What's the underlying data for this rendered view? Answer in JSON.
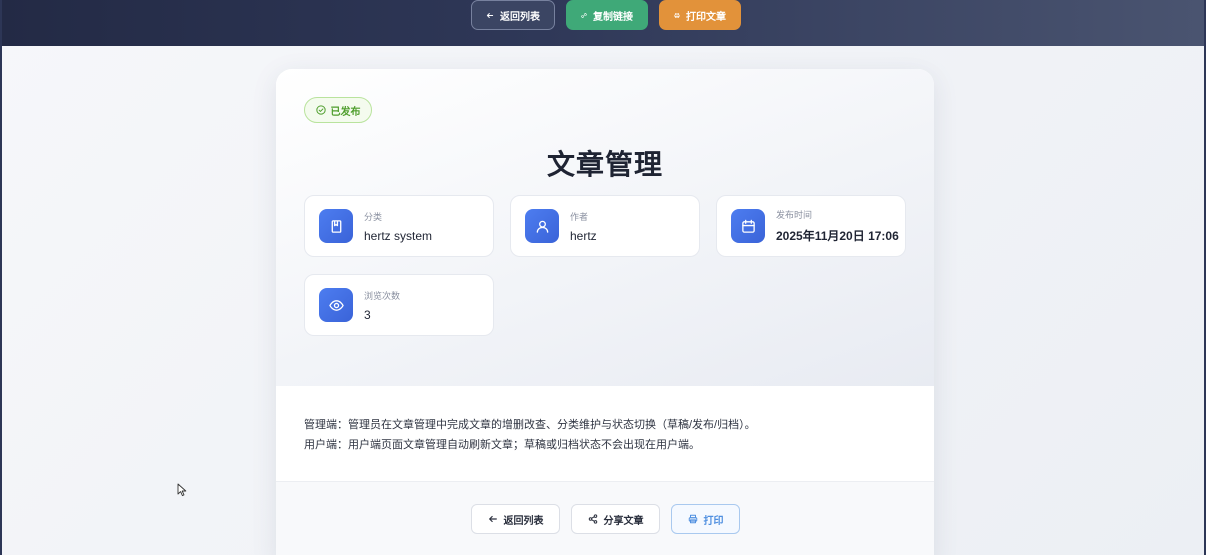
{
  "topbar": {
    "back_label": "返回列表",
    "copy_label": "复制链接",
    "print_label": "打印文章"
  },
  "article": {
    "status": "已发布",
    "title": "文章管理",
    "meta": [
      {
        "label": "分类",
        "value": "hertz system",
        "icon": "book-icon"
      },
      {
        "label": "作者",
        "value": "hertz",
        "icon": "user-icon"
      },
      {
        "label": "发布时间",
        "value": "2025年11月20日 17:06",
        "icon": "calendar-icon"
      },
      {
        "label": "浏览次数",
        "value": "3",
        "icon": "eye-icon"
      }
    ],
    "body": [
      "管理端：管理员在文章管理中完成文章的增删改查、分类维护与状态切换（草稿/发布/归档）。",
      "用户端：用户端页面文章管理自动刷新文章；草稿或归档状态不会出现在用户端。"
    ]
  },
  "footer": {
    "back_label": "返回列表",
    "share_label": "分享文章",
    "print_label": "打印"
  },
  "colors": {
    "accent_blue": "#3a63d8",
    "success_green": "#3fa978",
    "warning_orange": "#e2923a",
    "status_green": "#4f9e2d"
  }
}
